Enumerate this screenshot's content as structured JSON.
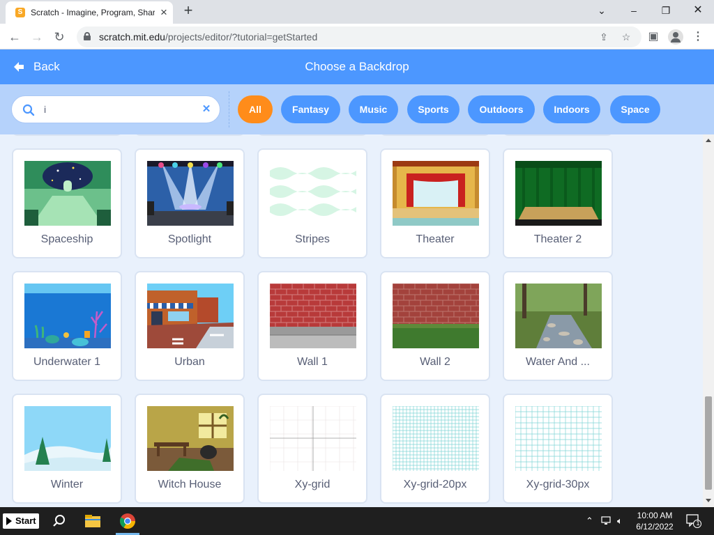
{
  "browser": {
    "tab_title": "Scratch - Imagine, Program, Shar",
    "favicon_letter": "S",
    "url_host": "scratch.mit.edu",
    "url_path": "/projects/editor/?tutorial=getStarted"
  },
  "header": {
    "back_label": "Back",
    "title": "Choose a Backdrop",
    "color": "#4c97ff"
  },
  "search": {
    "value": "i",
    "placeholder": "Search"
  },
  "filters": [
    {
      "label": "All",
      "active": true
    },
    {
      "label": "Fantasy",
      "active": false
    },
    {
      "label": "Music",
      "active": false
    },
    {
      "label": "Sports",
      "active": false
    },
    {
      "label": "Outdoors",
      "active": false
    },
    {
      "label": "Indoors",
      "active": false
    },
    {
      "label": "Space",
      "active": false
    }
  ],
  "backdrops": [
    {
      "label": "Spaceship",
      "art": "spaceship"
    },
    {
      "label": "Spotlight",
      "art": "spotlight"
    },
    {
      "label": "Stripes",
      "art": "stripes"
    },
    {
      "label": "Theater",
      "art": "theater"
    },
    {
      "label": "Theater 2",
      "art": "theater2"
    },
    {
      "label": "Underwater 1",
      "art": "underwater"
    },
    {
      "label": "Urban",
      "art": "urban"
    },
    {
      "label": "Wall 1",
      "art": "wall1"
    },
    {
      "label": "Wall 2",
      "art": "wall2"
    },
    {
      "label": "Water And ...",
      "art": "water"
    },
    {
      "label": "Winter",
      "art": "winter"
    },
    {
      "label": "Witch House",
      "art": "witch"
    },
    {
      "label": "Xy-grid",
      "art": "xygrid"
    },
    {
      "label": "Xy-grid-20px",
      "art": "grid20"
    },
    {
      "label": "Xy-grid-30px",
      "art": "grid30"
    }
  ],
  "taskbar": {
    "start_label": "Start",
    "time": "10:00 AM",
    "date": "6/12/2022",
    "notification_count": "1"
  },
  "colors": {
    "accent": "#4c97ff",
    "active_filter": "#ff8c1a",
    "filter_bar": "#b5d2fb",
    "card_text": "#575e75"
  }
}
